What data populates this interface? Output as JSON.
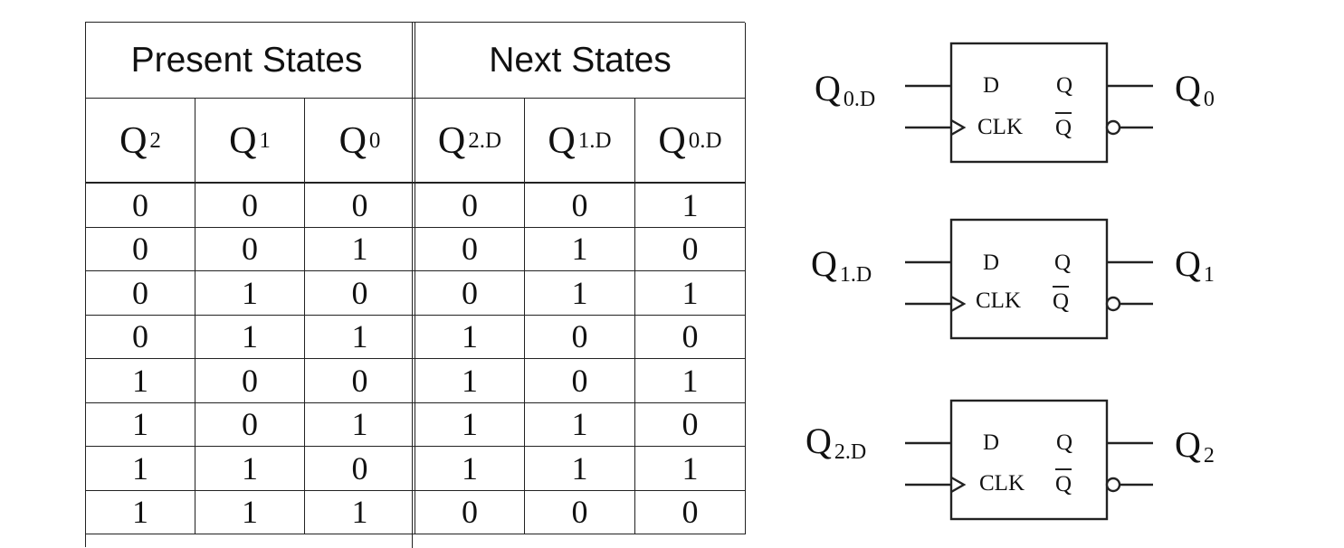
{
  "table": {
    "groups": {
      "present": "Present States",
      "next": "Next States"
    },
    "columns": [
      {
        "main": "Q",
        "sub": "2"
      },
      {
        "main": "Q",
        "sub": "1"
      },
      {
        "main": "Q",
        "sub": "0"
      },
      {
        "main": "Q",
        "sub": "2.D"
      },
      {
        "main": "Q",
        "sub": "1.D"
      },
      {
        "main": "Q",
        "sub": "0.D"
      }
    ],
    "rows": [
      [
        "0",
        "0",
        "0",
        "0",
        "0",
        "1"
      ],
      [
        "0",
        "0",
        "1",
        "0",
        "1",
        "0"
      ],
      [
        "0",
        "1",
        "0",
        "0",
        "1",
        "1"
      ],
      [
        "0",
        "1",
        "1",
        "1",
        "0",
        "0"
      ],
      [
        "1",
        "0",
        "0",
        "1",
        "0",
        "1"
      ],
      [
        "1",
        "0",
        "1",
        "1",
        "1",
        "0"
      ],
      [
        "1",
        "1",
        "0",
        "1",
        "1",
        "1"
      ],
      [
        "1",
        "1",
        "1",
        "0",
        "0",
        "0"
      ]
    ]
  },
  "flip_flops": [
    {
      "input": {
        "main": "Q",
        "sub": "0.D"
      },
      "output": {
        "main": "Q",
        "sub": "0"
      },
      "pin_d": "D",
      "pin_clk": "CLK",
      "pin_q": "Q",
      "pin_qbar": "Q"
    },
    {
      "input": {
        "main": "Q",
        "sub": "1.D"
      },
      "output": {
        "main": "Q",
        "sub": "1"
      },
      "pin_d": "D",
      "pin_clk": "CLK",
      "pin_q": "Q",
      "pin_qbar": "Q"
    },
    {
      "input": {
        "main": "Q",
        "sub": "2.D"
      },
      "output": {
        "main": "Q",
        "sub": "2"
      },
      "pin_d": "D",
      "pin_clk": "CLK",
      "pin_q": "Q",
      "pin_qbar": "Q"
    }
  ]
}
